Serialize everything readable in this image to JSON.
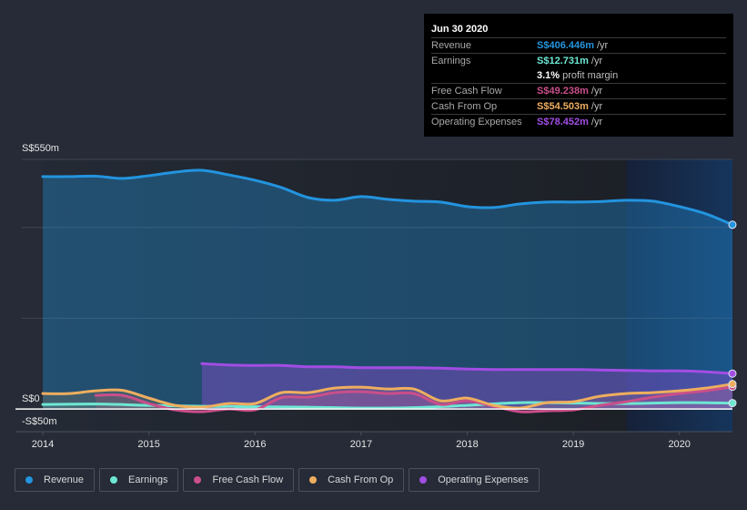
{
  "tooltip": {
    "date": "Jun 30 2020",
    "rows": [
      {
        "label": "Revenue",
        "value": "S$406.446m",
        "unit": "/yr",
        "color": "#2394df"
      },
      {
        "label": "Earnings",
        "value": "S$12.731m",
        "unit": "/yr",
        "color": "#6ee7d3"
      },
      {
        "label": "",
        "value": "3.1%",
        "unit": "profit margin",
        "color": "#ffffff"
      },
      {
        "label": "Free Cash Flow",
        "value": "S$49.238m",
        "unit": "/yr",
        "color": "#c94f8a"
      },
      {
        "label": "Cash From Op",
        "value": "S$54.503m",
        "unit": "/yr",
        "color": "#eeae5f"
      },
      {
        "label": "Operating Expenses",
        "value": "S$78.452m",
        "unit": "/yr",
        "color": "#a24de4"
      }
    ]
  },
  "legend": [
    {
      "label": "Revenue",
      "color": "#2394df"
    },
    {
      "label": "Earnings",
      "color": "#6ee7d3"
    },
    {
      "label": "Free Cash Flow",
      "color": "#c94f8a"
    },
    {
      "label": "Cash From Op",
      "color": "#eeae5f"
    },
    {
      "label": "Operating Expenses",
      "color": "#a24de4"
    }
  ],
  "chart_data": {
    "type": "area",
    "title": "",
    "xlabel": "",
    "ylabel": "",
    "y_tick_labels": [
      "S$550m",
      "S$0",
      "-S$50m"
    ],
    "ylim": [
      -50,
      550
    ],
    "xlim": [
      2014.0,
      2020.5
    ],
    "x_tick_labels": [
      "2014",
      "2015",
      "2016",
      "2017",
      "2018",
      "2019",
      "2020"
    ],
    "x_ticks": [
      2014,
      2015,
      2016,
      2017,
      2018,
      2019,
      2020
    ],
    "forecast_region_start": 2019.5,
    "series": [
      {
        "name": "Revenue",
        "color": "#2394df",
        "x": [
          2014.0,
          2014.25,
          2014.5,
          2014.75,
          2015.0,
          2015.25,
          2015.5,
          2015.75,
          2016.0,
          2016.25,
          2016.5,
          2016.75,
          2017.0,
          2017.25,
          2017.5,
          2017.75,
          2018.0,
          2018.25,
          2018.5,
          2018.75,
          2019.0,
          2019.25,
          2019.5,
          2019.75,
          2020.0,
          2020.25,
          2020.5
        ],
        "values": [
          512,
          512,
          513,
          508,
          514,
          522,
          526,
          516,
          504,
          488,
          466,
          460,
          468,
          462,
          458,
          456,
          446,
          444,
          452,
          456,
          456,
          457,
          460,
          458,
          446,
          430,
          406
        ]
      },
      {
        "name": "Earnings",
        "color": "#6ee7d3",
        "x": [
          2014.0,
          2014.5,
          2015.0,
          2015.5,
          2016.0,
          2016.5,
          2017.0,
          2017.5,
          2018.0,
          2018.5,
          2019.0,
          2019.5,
          2020.0,
          2020.5
        ],
        "values": [
          10,
          11,
          8,
          6,
          5,
          4,
          2,
          3,
          8,
          14,
          13,
          12,
          14,
          13
        ]
      },
      {
        "name": "Free Cash Flow",
        "color": "#c94f8a",
        "x": [
          2014.5,
          2014.75,
          2015.0,
          2015.25,
          2015.5,
          2015.75,
          2016.0,
          2016.25,
          2016.5,
          2016.75,
          2017.0,
          2017.25,
          2017.5,
          2017.75,
          2018.0,
          2018.25,
          2018.5,
          2018.75,
          2019.0,
          2019.25,
          2019.5,
          2019.75,
          2020.0,
          2020.25,
          2020.5
        ],
        "values": [
          30,
          30,
          12,
          -2,
          -6,
          0,
          -2,
          25,
          26,
          36,
          38,
          34,
          34,
          10,
          18,
          6,
          -6,
          -4,
          -2,
          8,
          16,
          26,
          34,
          40,
          49
        ]
      },
      {
        "name": "Cash From Op",
        "color": "#eeae5f",
        "x": [
          2014.0,
          2014.25,
          2014.5,
          2014.75,
          2015.0,
          2015.25,
          2015.5,
          2015.75,
          2016.0,
          2016.25,
          2016.5,
          2016.75,
          2017.0,
          2017.25,
          2017.5,
          2017.75,
          2018.0,
          2018.25,
          2018.5,
          2018.75,
          2019.0,
          2019.25,
          2019.5,
          2019.75,
          2020.0,
          2020.25,
          2020.5
        ],
        "values": [
          34,
          34,
          40,
          41,
          24,
          8,
          4,
          12,
          12,
          36,
          36,
          46,
          48,
          44,
          44,
          18,
          24,
          8,
          2,
          14,
          16,
          28,
          34,
          36,
          40,
          46,
          55
        ]
      },
      {
        "name": "Operating Expenses",
        "color": "#a24de4",
        "x": [
          2015.5,
          2015.75,
          2016.0,
          2016.25,
          2016.5,
          2016.75,
          2017.0,
          2017.25,
          2017.5,
          2017.75,
          2018.0,
          2018.25,
          2018.5,
          2018.75,
          2019.0,
          2019.25,
          2019.5,
          2019.75,
          2020.0,
          2020.25,
          2020.5
        ],
        "values": [
          100,
          97,
          96,
          96,
          93,
          93,
          91,
          91,
          91,
          90,
          88,
          87,
          87,
          87,
          87,
          86,
          85,
          84,
          84,
          82,
          78
        ]
      }
    ]
  }
}
